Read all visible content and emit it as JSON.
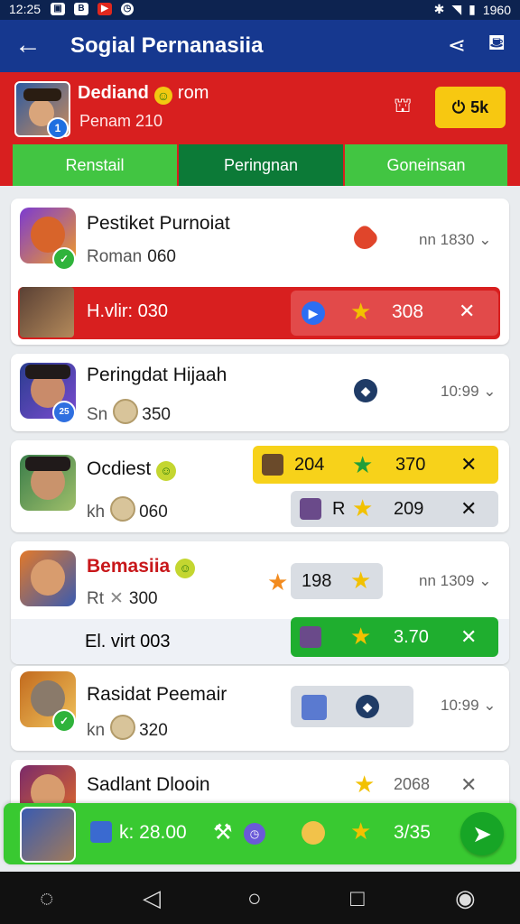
{
  "status": {
    "time": "12:25",
    "battery": "1960"
  },
  "appbar": {
    "back_icon": "arrow-left-icon",
    "title": "Sogial Pernanasiia",
    "share_icon": "share-icon",
    "cart_icon": "cart-icon"
  },
  "profile": {
    "name": "Dediand",
    "name_tail": "rom",
    "sub": "Penam 210",
    "badge": "1",
    "coin_value": "5k"
  },
  "tabs": [
    "Renstail",
    "Peringnan",
    "Goneinsan"
  ],
  "cards": [
    {
      "title": "Pestiket Purnoiat",
      "sub_label": "Roman",
      "sub_value": "060",
      "meta": "nn 1830",
      "row_label": "H.vlir:",
      "row_value": "030",
      "row_score": "308"
    },
    {
      "title": "Peringdat Hijaah",
      "sub_label": "Sn",
      "sub_value": "350",
      "meta": "10:99"
    },
    {
      "title": "Ocdiest",
      "sub_label": "kh",
      "sub_value": "060",
      "pill1_value": "204",
      "pill1_score": "370",
      "pill2_label": "R",
      "pill2_score": "209"
    },
    {
      "title": "Bemasiia",
      "sub_label": "Rt",
      "sub_value": "300",
      "mid_value": "198",
      "meta": "nn 1309",
      "row_label": "El. virt",
      "row_value": "003",
      "row_score": "3.70"
    },
    {
      "title": "Rasidat Peemair",
      "sub_label": "kn",
      "sub_value": "320",
      "meta": "10:99"
    },
    {
      "title": "Sadlant Dlooin",
      "meta": "2068"
    }
  ],
  "bottom_cta": {
    "label": "k: 28.00",
    "score": "3/35"
  },
  "colors": {
    "appbar": "#16388f",
    "profile_bg": "#d81f1f",
    "tab_active": "#0c7a37",
    "tab": "#42c542",
    "gold": "#f7c811"
  }
}
